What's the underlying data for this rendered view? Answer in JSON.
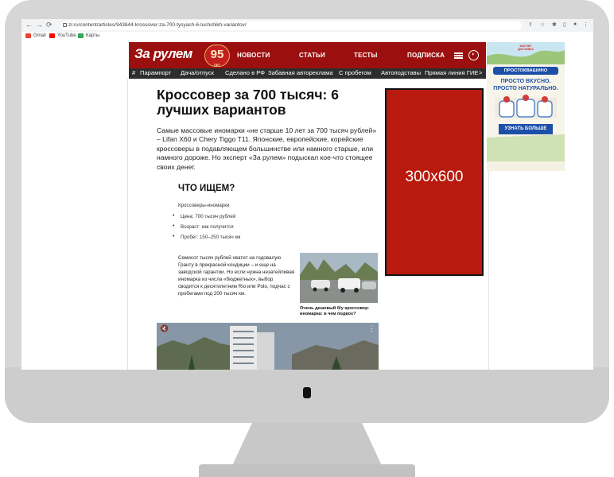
{
  "browser": {
    "url": "zr.ru/content/articles/943844-krossover-za-700-tysyach-6-luchshikh-variantov/",
    "bookmarks": [
      {
        "label": "Gmail",
        "color": "#ea4335"
      },
      {
        "label": "YouTube",
        "color": "#ff0000"
      },
      {
        "label": "Карты",
        "color": "#34a853"
      }
    ]
  },
  "site": {
    "logo": "За рулем",
    "badge_number": "95",
    "badge_sub": "ЛЕТ",
    "nav": [
      "НОВОСТИ",
      "СТАТЬИ",
      "ТЕСТЫ",
      "ПОДПИСКА"
    ],
    "subnav": [
      "#",
      "Парампорт",
      "Дача/отпуск",
      "Сделано в РФ",
      "Забавная автореклама",
      "С пробегом",
      "Автоподставы",
      "Прямая линия ГИЕ",
      ">"
    ],
    "colors": {
      "header": "#9c0f0f",
      "subnav": "#2d2d2d"
    }
  },
  "article": {
    "title": "Кроссовер за 700 тысяч: 6 лучших вариантов",
    "lead": "Самые массовые иномарки «не старше 10 лет за 700 тысяч рублей» – Lifan X60 и Chery Tiggo T11. Японские, европейские, корейские кроссоверы в подавляющем большинстве или намного старше, или намного дороже. Но эксперт «За рулем» подыскал кое-что стоящее своих денег.",
    "what_heading": "ЧТО ИЩЕМ?",
    "criteria_head": "Кроссоверы-иномарки",
    "criteria": [
      "Цена: 700 тысяч рублей",
      "Возраст: как получится",
      "Пробег: 150–250 тысяч км"
    ],
    "body": "Семисот тысяч рублей хватит на годовалую Гранту в прекрасной кондиции – и еще на заводской гарантии. Но если нужна незатейливая иномарка из числа «бюджетных», выбор сводится к десятилетним Rio или Polo, подчас с пробегами под 200 тысяч км.",
    "related_caption": "Очень дешевый б/у кроссовер-иномарка: в чем подвох?"
  },
  "ads": {
    "placeholder": "300x600",
    "brand": "ПРОСТОКВАШИНО",
    "line1": "ПРОСТО ВКУСНО.",
    "line2": "ПРОСТО НАТУРАЛЬНО.",
    "cta": "УЗНАТЬ БОЛЬШЕ",
    "store": "МАГНИТ ДОСТАВКА"
  }
}
